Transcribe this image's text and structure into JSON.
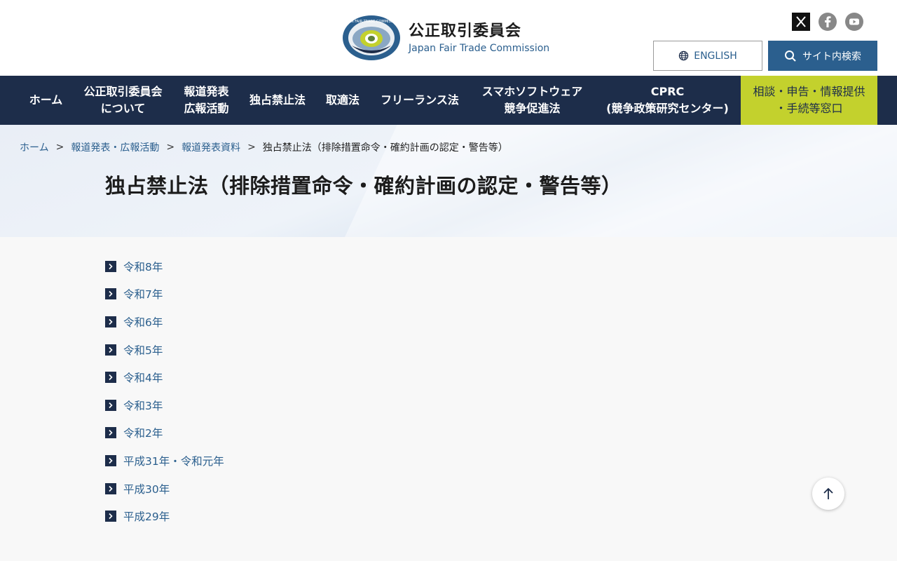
{
  "header": {
    "logo_title": "公正取引委員会",
    "logo_subtitle": "Japan Fair Trade Commission",
    "logo_ring_text": "JAPAN FAIR TRADE COMMISSION",
    "english_label": "ENGLISH",
    "search_label": "サイト内検索",
    "social_icons": [
      "x-icon",
      "facebook-icon",
      "youtube-icon"
    ]
  },
  "nav": {
    "items": [
      {
        "line1": "ホーム",
        "line2": ""
      },
      {
        "line1": "公正取引委員会",
        "line2": "について"
      },
      {
        "line1": "報道発表",
        "line2": "広報活動"
      },
      {
        "line1": "独占禁止法",
        "line2": ""
      },
      {
        "line1": "取適法",
        "line2": ""
      },
      {
        "line1": "フリーランス法",
        "line2": ""
      },
      {
        "line1": "スマホソフトウェア",
        "line2": "競争促進法"
      },
      {
        "line1": "CPRC",
        "line2": "(競争政策研究センター)"
      },
      {
        "line1": "相談・申告・情報提供",
        "line2": "・手続等窓口"
      }
    ]
  },
  "breadcrumb": {
    "items": [
      "ホーム",
      "報道発表・広報活動",
      "報道発表資料"
    ],
    "current": "独占禁止法（排除措置命令・確約計画の認定・警告等）",
    "separator": ">"
  },
  "page": {
    "title": "独占禁止法（排除措置命令・確約計画の認定・警告等）"
  },
  "years": [
    "令和8年",
    "令和7年",
    "令和6年",
    "令和5年",
    "令和4年",
    "令和3年",
    "令和2年",
    "平成31年・令和元年",
    "平成30年",
    "平成29年"
  ],
  "colors": {
    "navy": "#1d2d4a",
    "accent_blue": "#2b5f8e",
    "consult_green": "#c3d12d"
  }
}
